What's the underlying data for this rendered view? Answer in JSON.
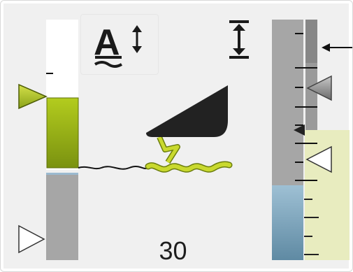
{
  "depth_value": "30",
  "colors": {
    "accent_green": "#a7c21a",
    "gauge_grey": "#a6a6a6",
    "water_blue": "#7ba6be",
    "highlight_yellow": "#e8ecbf"
  },
  "icons": {
    "left": "ride-height-lever-icon",
    "top_center": "text-height-icon",
    "top_right": "adjust-range-icon",
    "arrow": "pointer-arrow-icon"
  }
}
